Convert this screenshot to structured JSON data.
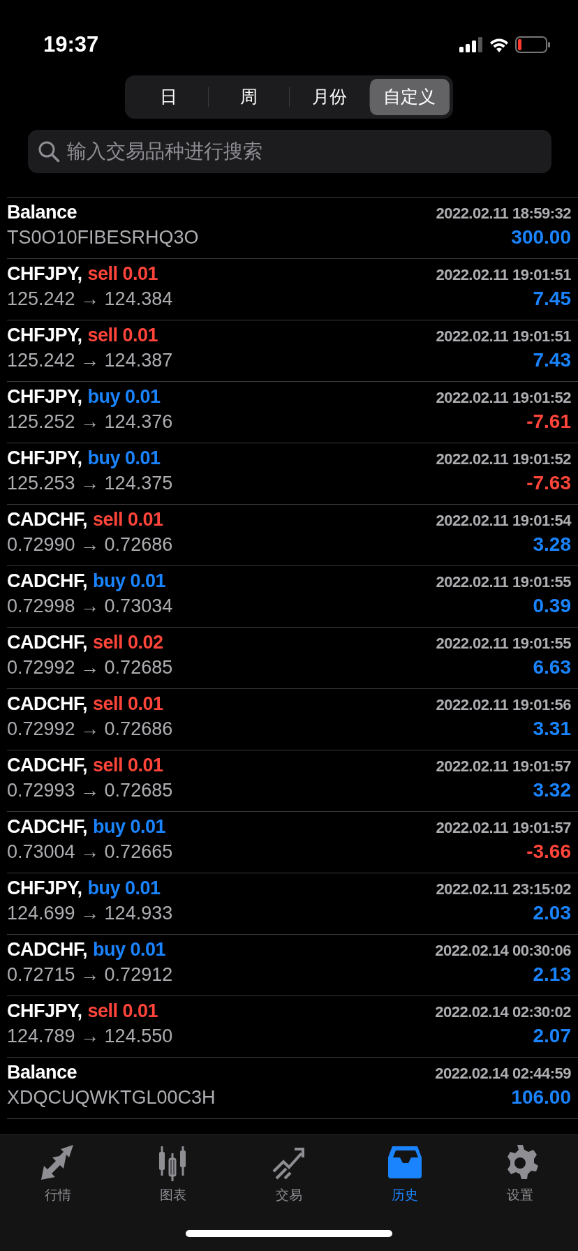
{
  "status_bar": {
    "time": "19:37"
  },
  "segments": [
    {
      "label": "日",
      "selected": false
    },
    {
      "label": "周",
      "selected": false
    },
    {
      "label": "月份",
      "selected": false
    },
    {
      "label": "自定义",
      "selected": true
    }
  ],
  "search": {
    "placeholder": "输入交易品种进行搜索"
  },
  "rows": [
    {
      "kind": "balance",
      "title": "Balance",
      "time": "2022.02.11 18:59:32",
      "detail": "TS0O10FIBESRHQ3O",
      "amount": "300.00",
      "negative": false
    },
    {
      "kind": "sell",
      "title": "CHFJPY,",
      "order": "sell 0.01",
      "time": "2022.02.11 19:01:51",
      "detail": "125.242 → 124.384",
      "amount": "7.45",
      "negative": false
    },
    {
      "kind": "sell",
      "title": "CHFJPY,",
      "order": "sell 0.01",
      "time": "2022.02.11 19:01:51",
      "detail": "125.242 → 124.387",
      "amount": "7.43",
      "negative": false
    },
    {
      "kind": "buy",
      "title": "CHFJPY,",
      "order": "buy 0.01",
      "time": "2022.02.11 19:01:52",
      "detail": "125.252 → 124.376",
      "amount": "-7.61",
      "negative": true
    },
    {
      "kind": "buy",
      "title": "CHFJPY,",
      "order": "buy 0.01",
      "time": "2022.02.11 19:01:52",
      "detail": "125.253 → 124.375",
      "amount": "-7.63",
      "negative": true
    },
    {
      "kind": "sell",
      "title": "CADCHF,",
      "order": "sell 0.01",
      "time": "2022.02.11 19:01:54",
      "detail": "0.72990 → 0.72686",
      "amount": "3.28",
      "negative": false
    },
    {
      "kind": "buy",
      "title": "CADCHF,",
      "order": "buy 0.01",
      "time": "2022.02.11 19:01:55",
      "detail": "0.72998 → 0.73034",
      "amount": "0.39",
      "negative": false
    },
    {
      "kind": "sell",
      "title": "CADCHF,",
      "order": "sell 0.02",
      "time": "2022.02.11 19:01:55",
      "detail": "0.72992 → 0.72685",
      "amount": "6.63",
      "negative": false
    },
    {
      "kind": "sell",
      "title": "CADCHF,",
      "order": "sell 0.01",
      "time": "2022.02.11 19:01:56",
      "detail": "0.72992 → 0.72686",
      "amount": "3.31",
      "negative": false
    },
    {
      "kind": "sell",
      "title": "CADCHF,",
      "order": "sell 0.01",
      "time": "2022.02.11 19:01:57",
      "detail": "0.72993 → 0.72685",
      "amount": "3.32",
      "negative": false
    },
    {
      "kind": "buy",
      "title": "CADCHF,",
      "order": "buy 0.01",
      "time": "2022.02.11 19:01:57",
      "detail": "0.73004 → 0.72665",
      "amount": "-3.66",
      "negative": true
    },
    {
      "kind": "buy",
      "title": "CHFJPY,",
      "order": "buy 0.01",
      "time": "2022.02.11 23:15:02",
      "detail": "124.699 → 124.933",
      "amount": "2.03",
      "negative": false
    },
    {
      "kind": "buy",
      "title": "CADCHF,",
      "order": "buy 0.01",
      "time": "2022.02.14 00:30:06",
      "detail": "0.72715 → 0.72912",
      "amount": "2.13",
      "negative": false
    },
    {
      "kind": "sell",
      "title": "CHFJPY,",
      "order": "sell 0.01",
      "time": "2022.02.14 02:30:02",
      "detail": "124.789 → 124.550",
      "amount": "2.07",
      "negative": false
    },
    {
      "kind": "balance",
      "title": "Balance",
      "time": "2022.02.14 02:44:59",
      "detail": "XDQCUQWKTGL00C3H",
      "amount": "106.00",
      "negative": false
    }
  ],
  "tab_bar": [
    {
      "kind": "quotes",
      "label": "行情",
      "selected": false
    },
    {
      "kind": "chart",
      "label": "图表",
      "selected": false
    },
    {
      "kind": "trade",
      "label": "交易",
      "selected": false
    },
    {
      "kind": "history",
      "label": "历史",
      "selected": true
    },
    {
      "kind": "settings",
      "label": "设置",
      "selected": false
    }
  ]
}
